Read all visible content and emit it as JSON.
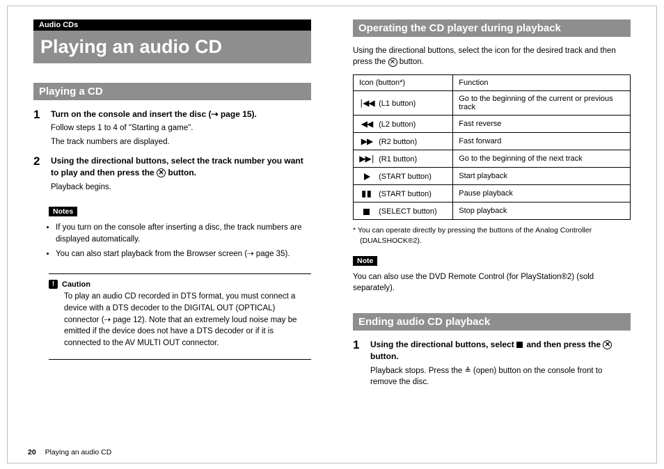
{
  "left": {
    "category": "Audio CDs",
    "title": "Playing an audio CD",
    "section1": "Playing a CD",
    "step1": {
      "num": "1",
      "head": "Turn on the console and insert the disc (⇢ page 15).",
      "l1": "Follow steps 1 to 4 of \"Starting a game\".",
      "l2": "The track numbers are displayed."
    },
    "step2": {
      "num": "2",
      "head_a": "Using the directional buttons, select the track number you want to play and then press the ",
      "head_b": " button.",
      "l1": "Playback begins."
    },
    "notesLabel": "Notes",
    "notes": [
      "If you turn on the console after inserting a disc, the track numbers are displayed automatically.",
      "You can also start playback from the Browser screen (⇢ page 35)."
    ],
    "cautionLabel": "Caution",
    "caution": "To play an audio CD recorded in DTS format, you must connect a device with a DTS decoder to the DIGITAL OUT (OPTICAL) connector (⇢ page 12). Note that an extremely loud noise may be emitted if the device does not have a DTS decoder or if it is connected to the AV MULTI OUT connector."
  },
  "right": {
    "section1": "Operating the CD player during playback",
    "intro_a": "Using the directional buttons, select the icon for the desired track and then press the ",
    "intro_b": " button.",
    "headers": {
      "icon": "Icon   (button*)",
      "func": "Function"
    },
    "rows": [
      {
        "icon": "prev-track",
        "btn": "(L1 button)",
        "func": "Go to the beginning of the current or previous track"
      },
      {
        "icon": "rewind",
        "btn": "(L2 button)",
        "func": "Fast reverse"
      },
      {
        "icon": "fforward",
        "btn": "(R2 button)",
        "func": "Fast forward"
      },
      {
        "icon": "next-track",
        "btn": "(R1 button)",
        "func": "Go to the beginning of the next track"
      },
      {
        "icon": "play",
        "btn": "(START button)",
        "func": "Start playback"
      },
      {
        "icon": "pause",
        "btn": "(START button)",
        "func": "Pause playback"
      },
      {
        "icon": "stop",
        "btn": "(SELECT button)",
        "func": "Stop playback"
      }
    ],
    "footnote": "*  You can operate directly by pressing the buttons of the Analog Controller (DUALSHOCK®2).",
    "noteLabel": "Note",
    "noteBody": "You can also use the DVD Remote Control (for PlayStation®2) (sold separately).",
    "section2": "Ending audio CD playback",
    "step1": {
      "num": "1",
      "head_a": "Using the directional buttons, select ",
      "head_b": " and then press the ",
      "head_c": " button.",
      "body_a": "Playback stops. Press the ",
      "body_b": " (open) button on the console front to remove the disc."
    }
  },
  "footer": {
    "page": "20",
    "title": "Playing an audio CD"
  }
}
